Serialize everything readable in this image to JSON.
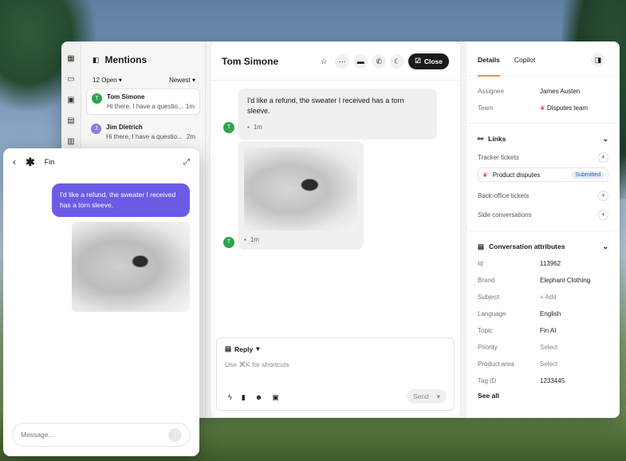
{
  "mentions": {
    "title": "Mentions",
    "filter_open": "12 Open",
    "filter_sort": "Newest",
    "items": [
      {
        "initial": "T",
        "name": "Tom Simone",
        "preview": "Hi there, I have a questio...",
        "time": "1m",
        "color": "#2ea44f"
      },
      {
        "initial": "J",
        "name": "Jim Dietrich",
        "preview": "Hi there, I have a questio...",
        "time": "2m",
        "color": "#8b7be8"
      }
    ]
  },
  "conversation": {
    "title": "Tom Simone",
    "close_label": "Close",
    "customer_initial": "T",
    "message_text": "I'd like a refund, the sweater I received has a torn sleeve.",
    "message_time": "1m",
    "image_time": "1m"
  },
  "composer": {
    "reply_label": "Reply",
    "placeholder": "Use ⌘K for shortcuts",
    "send_label": "Send"
  },
  "details": {
    "tabs": [
      "Details",
      "Copilot"
    ],
    "assignee_key": "Assignee",
    "assignee_value": "James Austen",
    "team_key": "Team",
    "team_value": "Disputes team",
    "links_title": "Links",
    "tracker_label": "Tracker tickets",
    "ticket_name": "Product disputes",
    "ticket_status": "Submitted",
    "backoffice_label": "Back-office tickets",
    "side_label": "Side conversations",
    "attributes_title": "Conversation attributes",
    "attributes": [
      {
        "k": "Id",
        "v": "113962"
      },
      {
        "k": "Brand",
        "v": "Elephant Clothing"
      },
      {
        "k": "Subject",
        "v": "+ Add"
      },
      {
        "k": "Language",
        "v": "English"
      },
      {
        "k": "Topic",
        "v": "Fin AI"
      },
      {
        "k": "Priority",
        "v": "Select"
      },
      {
        "k": "Product area",
        "v": "Select"
      },
      {
        "k": "Tag ID",
        "v": "1233445"
      }
    ],
    "see_all": "See all"
  },
  "fin": {
    "title": "Fin",
    "message": "I'd like a refund, the sweater I received has a torn sleeve.",
    "input_placeholder": "Message..."
  }
}
